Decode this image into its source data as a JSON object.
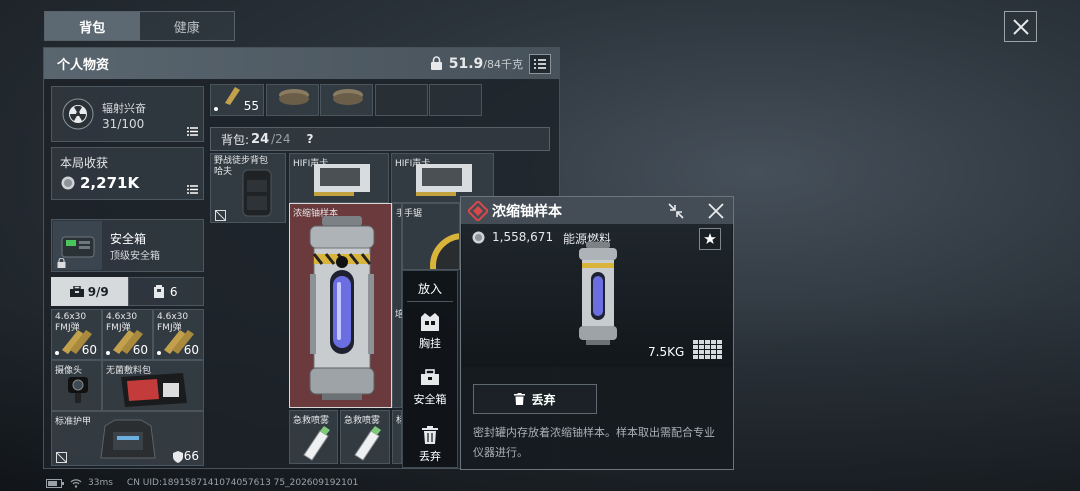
{
  "tabs": [
    {
      "label": "背包",
      "active": true
    },
    {
      "label": "健康",
      "active": false
    }
  ],
  "panel": {
    "title": "个人物资",
    "weight_value": "51.9",
    "weight_max": "/84千克"
  },
  "sidebar": {
    "status": {
      "name": "辐射兴奋",
      "value": "31/100"
    },
    "harvest": {
      "label": "本局收获",
      "value": "2,271K"
    },
    "safebox": {
      "name": "安全箱",
      "sub": "顶级安全箱"
    },
    "tabs": [
      {
        "label": "9/9"
      },
      {
        "label": "6"
      }
    ],
    "items": [
      {
        "name": "4.6x30 FMJ弹",
        "count": "60"
      },
      {
        "name": "4.6x30 FMJ弹",
        "count": "60"
      },
      {
        "name": "4.6x30 FMJ弹",
        "count": "60"
      },
      {
        "name": "摄像头"
      },
      {
        "name": "无菌敷料包"
      },
      {
        "name": "标准护甲",
        "count": "66"
      }
    ]
  },
  "backpack": {
    "top_count": "55",
    "header_label": "背包: ",
    "count": "24",
    "max": "/24",
    "help": "?",
    "items": [
      {
        "name": "野战徒步背包哈夫"
      },
      {
        "name": "HIFI声卡"
      },
      {
        "name": "HIFI声卡"
      },
      {
        "name": "浓缩铀样本"
      },
      {
        "name": "手锯"
      },
      {
        "name": "急救喷雾"
      },
      {
        "name": "急救喷雾"
      },
      {
        "name": "标"
      },
      {
        "name": "培"
      }
    ]
  },
  "context_menu": {
    "items": [
      {
        "label": "放入"
      },
      {
        "label": "胸挂"
      },
      {
        "label": "安全箱"
      },
      {
        "label": "丢弃"
      }
    ]
  },
  "detail": {
    "title": "浓缩铀样本",
    "price": "1,558,671",
    "category": "能源燃料",
    "weight": "7.5KG",
    "discard_label": "丢弃",
    "description": "密封罐内存放着浓缩铀样本。样本取出需配合专业仪器进行。"
  },
  "statusbar": {
    "ping": "33ms",
    "uid": "CN UID:1891587141074057613 75_202609192101"
  },
  "colors": {
    "accent_red": "#d8484b",
    "highlight_slot": "#6b3a3c",
    "panel_header": "#56626b"
  },
  "icons": [
    "close-icon",
    "lock-icon",
    "list-icon",
    "radiation-icon",
    "coin-icon",
    "toolbox-icon",
    "vest-icon",
    "trash-icon",
    "star-icon",
    "shrink-icon",
    "grid-size-icon",
    "wifi-icon",
    "battery-icon",
    "no-insure-icon",
    "shield-icon"
  ]
}
